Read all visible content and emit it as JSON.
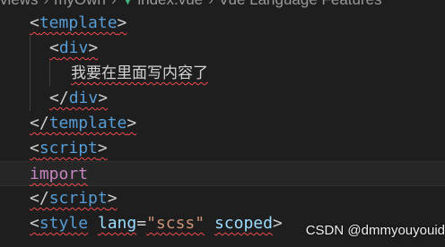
{
  "breadcrumb": {
    "items": [
      "views",
      "myOwn",
      "index.vue",
      "Vue Language Features"
    ],
    "file_icon": "vue-icon"
  },
  "code": {
    "line1": {
      "open": "<",
      "tag": "template",
      "close": ">"
    },
    "line2": {
      "open": "<",
      "tag": "div",
      "close": ">"
    },
    "line3": {
      "text": "我要在里面写内容了"
    },
    "line4": {
      "open": "</",
      "tag": "div",
      "close": ">"
    },
    "line5": {
      "open": "</",
      "tag": "template",
      "close": ">"
    },
    "line6": {
      "open": "<",
      "tag": "script",
      "close": ">"
    },
    "line7": {
      "keyword": "import"
    },
    "line8": {
      "open": "</",
      "tag": "script",
      "close": ">"
    },
    "line9": {
      "open": "<",
      "tag": "style",
      "attr1": "lang",
      "eq": "=",
      "value": "\"scss\"",
      "attr2": "scoped",
      "close": ">"
    }
  },
  "watermark": "CSDN @dmmyouyouid",
  "colors": {
    "background": "#1e1e1e",
    "tag": "#569cd6",
    "attribute": "#9cdcfe",
    "string": "#ce9178",
    "keyword": "#c586c0",
    "error_squiggle": "#f14c4c"
  }
}
